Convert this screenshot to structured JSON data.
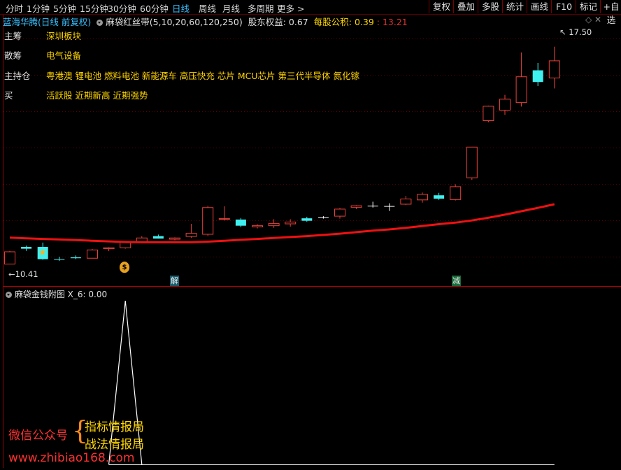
{
  "toolbar": {
    "periods": [
      "分时",
      "1分钟",
      "5分钟",
      "15分钟",
      "30分钟",
      "60分钟",
      "日线",
      "周线",
      "月线",
      "多周期",
      "更多"
    ],
    "active_period": "日线",
    "more_arrow": ">",
    "right_buttons": [
      "复权",
      "叠加",
      "多股",
      "统计",
      "画线",
      "F10",
      "标记",
      "+自选"
    ]
  },
  "info_bar": {
    "stock": "蓝海华腾(日线 前复权)",
    "indicator": "麻袋红丝带(5,10,20,60,120,250)",
    "equity_label": "股东权益:",
    "equity_value": "0.67",
    "fund_label": "每股公积:",
    "fund_value": "0.39",
    "extra_value": "13.21"
  },
  "labels": [
    {
      "key": "主筹",
      "value": "深圳板块"
    },
    {
      "key": "散筹",
      "value": "电气设备"
    },
    {
      "key": "主持仓",
      "value": "粤港澳 锂电池 燃料电池 新能源车 高压快充 芯片 MCU芯片 第三代半导体 氮化镓"
    },
    {
      "key": "买",
      "value": "活跃股 近期新高 近期强势"
    }
  ],
  "price_annotations": {
    "high": "17.50",
    "low": "10.41"
  },
  "markers": {
    "jie": "解",
    "jian": "减",
    "moneybag": "$"
  },
  "sub_chart": {
    "title": "麻袋金钱附图",
    "series_label": "X_6:",
    "series_value": "0.00"
  },
  "watermark": {
    "wechat_label": "微信公众号",
    "line1": "指标情报局",
    "line2": "战法情报局",
    "url": "www.zhibiao168.com"
  },
  "colors": {
    "up": "#e8413a",
    "down": "#3ff0f0",
    "ma": "#ee1111",
    "accent": "#39c0ff",
    "label": "#ffd700"
  },
  "chart_data": {
    "type": "candlestick",
    "ylim": [
      10.0,
      18.2
    ],
    "candles": [
      {
        "o": 10.42,
        "h": 10.85,
        "l": 10.41,
        "c": 10.82
      },
      {
        "o": 10.98,
        "h": 11.02,
        "l": 10.85,
        "c": 10.92
      },
      {
        "o": 10.98,
        "h": 11.12,
        "l": 10.56,
        "c": 10.58
      },
      {
        "o": 10.58,
        "h": 10.66,
        "l": 10.52,
        "c": 10.56
      },
      {
        "o": 10.64,
        "h": 10.7,
        "l": 10.58,
        "c": 10.61
      },
      {
        "o": 10.61,
        "h": 10.91,
        "l": 10.61,
        "c": 10.88
      },
      {
        "o": 10.92,
        "h": 10.97,
        "l": 10.84,
        "c": 10.95
      },
      {
        "o": 10.95,
        "h": 11.16,
        "l": 10.92,
        "c": 11.13
      },
      {
        "o": 11.13,
        "h": 11.33,
        "l": 11.1,
        "c": 11.27
      },
      {
        "o": 11.33,
        "h": 11.38,
        "l": 11.25,
        "c": 11.25
      },
      {
        "o": 11.23,
        "h": 11.29,
        "l": 11.19,
        "c": 11.27
      },
      {
        "o": 11.32,
        "h": 11.73,
        "l": 11.27,
        "c": 11.42
      },
      {
        "o": 11.39,
        "h": 12.32,
        "l": 11.33,
        "c": 12.26
      },
      {
        "o": 11.88,
        "h": 12.3,
        "l": 11.84,
        "c": 11.9
      },
      {
        "o": 11.87,
        "h": 11.92,
        "l": 11.62,
        "c": 11.67
      },
      {
        "o": 11.63,
        "h": 11.72,
        "l": 11.58,
        "c": 11.67
      },
      {
        "o": 11.67,
        "h": 11.88,
        "l": 11.6,
        "c": 11.74
      },
      {
        "o": 11.73,
        "h": 11.88,
        "l": 11.64,
        "c": 11.79
      },
      {
        "o": 11.91,
        "h": 11.96,
        "l": 11.8,
        "c": 11.83
      },
      {
        "o": 11.95,
        "h": 11.98,
        "l": 11.9,
        "c": 11.95
      },
      {
        "o": 11.98,
        "h": 12.25,
        "l": 11.9,
        "c": 12.21
      },
      {
        "o": 12.27,
        "h": 12.34,
        "l": 12.21,
        "c": 12.32
      },
      {
        "o": 12.32,
        "h": 12.45,
        "l": 12.26,
        "c": 12.32
      },
      {
        "o": 12.31,
        "h": 12.4,
        "l": 12.15,
        "c": 12.31
      },
      {
        "o": 12.37,
        "h": 12.64,
        "l": 12.34,
        "c": 12.54
      },
      {
        "o": 12.51,
        "h": 12.75,
        "l": 12.42,
        "c": 12.69
      },
      {
        "o": 12.66,
        "h": 12.74,
        "l": 12.51,
        "c": 12.55
      },
      {
        "o": 12.52,
        "h": 13.02,
        "l": 12.49,
        "c": 12.94
      },
      {
        "o": 13.23,
        "h": 14.23,
        "l": 13.16,
        "c": 14.23
      },
      {
        "o": 15.09,
        "h": 15.58,
        "l": 15.04,
        "c": 15.56
      },
      {
        "o": 15.43,
        "h": 15.93,
        "l": 15.28,
        "c": 15.79
      },
      {
        "o": 15.68,
        "h": 17.31,
        "l": 15.55,
        "c": 16.52
      },
      {
        "o": 16.73,
        "h": 16.97,
        "l": 16.22,
        "c": 16.35
      },
      {
        "o": 16.48,
        "h": 17.5,
        "l": 16.14,
        "c": 17.04
      }
    ],
    "ma": [
      11.28,
      11.26,
      11.24,
      11.22,
      11.2,
      11.18,
      11.16,
      11.14,
      11.13,
      11.13,
      11.13,
      11.13,
      11.15,
      11.18,
      11.21,
      11.24,
      11.27,
      11.3,
      11.33,
      11.37,
      11.41,
      11.46,
      11.51,
      11.55,
      11.6,
      11.66,
      11.72,
      11.77,
      11.84,
      11.93,
      12.03,
      12.14,
      12.25,
      12.37
    ],
    "sub_series": {
      "name": "X_6",
      "spike_index": 7,
      "ylim": [
        0,
        1
      ]
    }
  }
}
